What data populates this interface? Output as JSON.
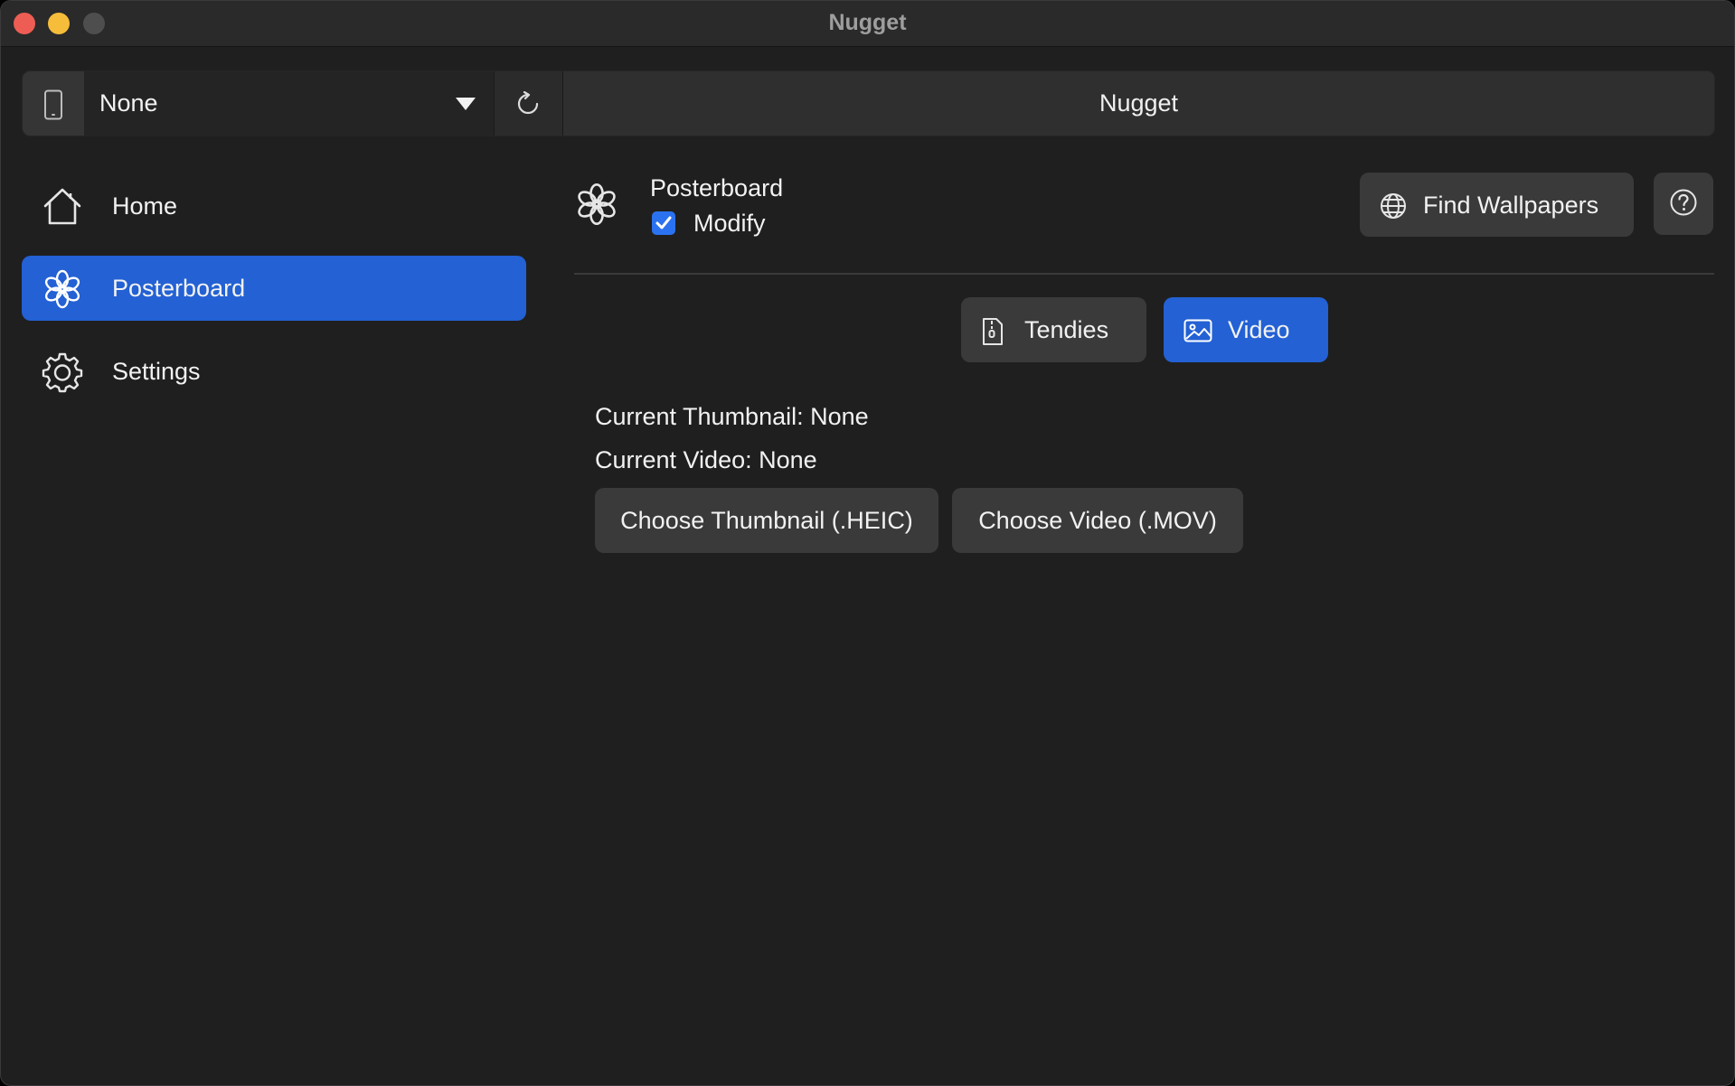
{
  "window": {
    "title": "Nugget"
  },
  "toolbar": {
    "device_value": "None",
    "title": "Nugget"
  },
  "sidebar": {
    "items": [
      {
        "label": "Home",
        "icon": "home-icon"
      },
      {
        "label": "Posterboard",
        "icon": "flower-icon",
        "active": true
      },
      {
        "label": "Settings",
        "icon": "gear-icon"
      }
    ]
  },
  "main": {
    "page_title": "Posterboard",
    "modify_label": "Modify",
    "modify_checked": true,
    "find_wallpapers_label": "Find Wallpapers",
    "tabs": [
      {
        "label": "Tendies",
        "icon": "file-zip-icon",
        "active": false
      },
      {
        "label": "Video",
        "icon": "photo-icon",
        "active": true
      }
    ],
    "current_thumbnail": "Current Thumbnail: None",
    "current_video": "Current Video: None",
    "choose_thumbnail_label": "Choose Thumbnail (.HEIC)",
    "choose_video_label": "Choose Video (.MOV)"
  },
  "colors": {
    "accent": "#2361d4",
    "background": "#1f1f1f",
    "button": "#3a3a3a"
  }
}
